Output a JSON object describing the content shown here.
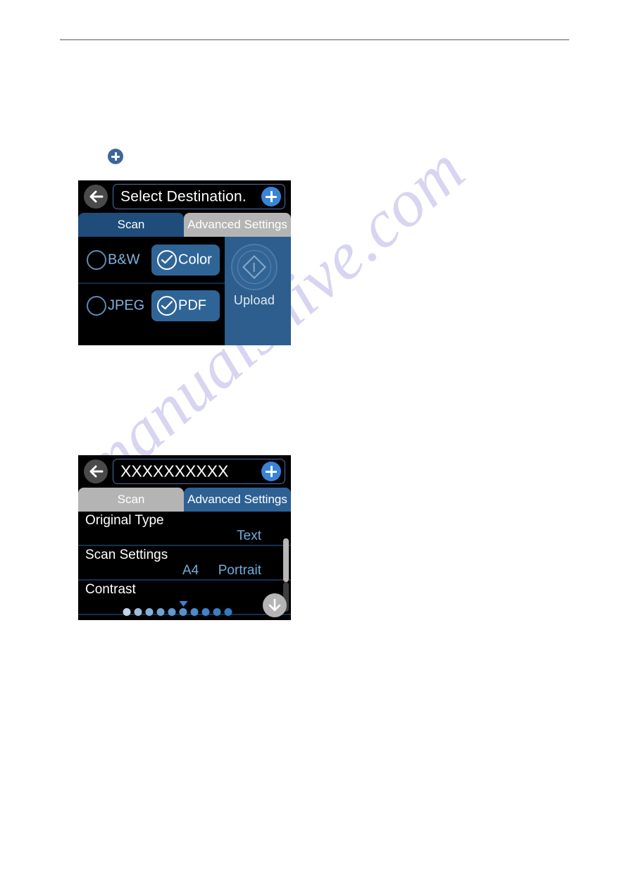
{
  "page": {
    "background_color": "#ffffff",
    "header_rule_color": "#5a5a5a"
  },
  "watermark": {
    "text": "manualshive.com",
    "color": "#b9b4e8"
  },
  "inline_marker": {
    "icon": "plus-circle-icon",
    "color": "#3d6598"
  },
  "screens": [
    {
      "id": "scan-screen",
      "back_icon": "back-arrow-icon",
      "title": "Select Destination.",
      "add_icon": "plus-circle-icon",
      "tabs": [
        {
          "label": "Scan",
          "state": "active"
        },
        {
          "label": "Advanced Settings",
          "state": "inactive"
        }
      ],
      "options": [
        {
          "unselected": {
            "label": "B&W",
            "icon": "radio-empty-icon"
          },
          "selected": {
            "label": "Color",
            "icon": "check-circle-icon"
          }
        },
        {
          "unselected": {
            "label": "JPEG",
            "icon": "radio-empty-icon"
          },
          "selected": {
            "label": "PDF",
            "icon": "check-circle-icon"
          }
        }
      ],
      "action": {
        "label": "Upload",
        "icon": "start-diamond-icon",
        "state": "dimmed"
      }
    },
    {
      "id": "advanced-screen",
      "back_icon": "back-arrow-icon",
      "title": "XXXXXXXXXX",
      "add_icon": "plus-circle-icon",
      "tabs": [
        {
          "label": "Scan",
          "state": "inactive"
        },
        {
          "label": "Advanced Settings",
          "state": "active"
        }
      ],
      "settings": [
        {
          "name": "Original Type",
          "value_right": "Text",
          "value_center": ""
        },
        {
          "name": "Scan Settings",
          "value_right": "Portrait",
          "value_center": "A4"
        },
        {
          "name": "Contrast",
          "value_right": "",
          "value_center": ""
        }
      ],
      "scroll_down_icon": "down-arrow-icon",
      "pager": {
        "total_dots": 10,
        "marker_index": 5,
        "dot_colors": [
          "#c3d4e6",
          "#9dbcdc",
          "#86afd8",
          "#6fa2d4",
          "#5e98d0",
          "#5392cd",
          "#4a8bca",
          "#3f84c6",
          "#3b7fc2",
          "#3579bd"
        ]
      }
    }
  ]
}
